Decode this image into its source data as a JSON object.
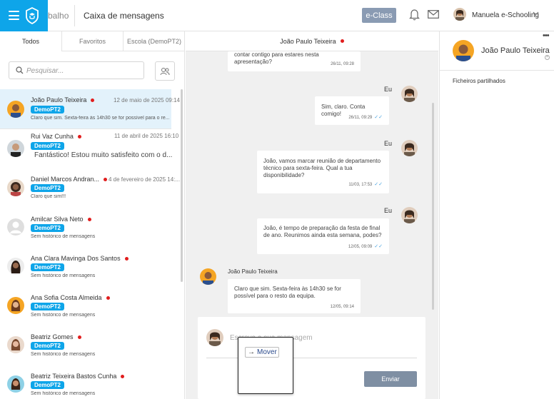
{
  "header": {
    "crumb": "balho",
    "title": "Caixa de mensagens",
    "eclass_label": "e-Class",
    "user_name": "Manuela e-Schooling"
  },
  "tabs": [
    {
      "label": "Todos",
      "active": true
    },
    {
      "label": "Favoritos",
      "active": false
    },
    {
      "label": "Escola (DemoPT2)",
      "active": false
    }
  ],
  "search": {
    "placeholder": "Pesquisar..."
  },
  "conversations": [
    {
      "name": "João Paulo Teixeira",
      "date": "12 de maio de 2025 09:14",
      "tag": "DemoPT2",
      "preview": "Claro que sim. Sexta-feira às 14h30 se for possível para o re...",
      "unread": true,
      "selected": true
    },
    {
      "name": "Rui Vaz Cunha",
      "date": "11 de abril de 2025 16:10",
      "tag": "DemoPT2",
      "preview": "Fantástico! Estou muito satisfeito com o d...",
      "unread": true,
      "selected": false
    },
    {
      "name": "Daniel Marcos Andran...",
      "date": "4 de fevereiro de 2025 14:...",
      "tag": "DemoPT2",
      "preview": "Claro que sim!!!",
      "unread": true,
      "selected": false
    },
    {
      "name": "Amilcar Silva Neto",
      "date": "",
      "tag": "DemoPT2",
      "preview": "Sem histórico de mensagens",
      "unread": true,
      "selected": false
    },
    {
      "name": "Ana Clara Mavinga Dos Santos",
      "date": "",
      "tag": "DemoPT2",
      "preview": "Sem histórico de mensagens",
      "unread": true,
      "selected": false
    },
    {
      "name": "Ana Sofia Costa Almeida",
      "date": "",
      "tag": "DemoPT2",
      "preview": "Sem histórico de mensagens",
      "unread": true,
      "selected": false
    },
    {
      "name": "Beatriz Gomes",
      "date": "",
      "tag": "DemoPT2",
      "preview": "Sem histórico de mensagens",
      "unread": true,
      "selected": false
    },
    {
      "name": "Beatriz Teixeira Bastos Cunha",
      "date": "",
      "tag": "DemoPT2",
      "preview": "Sem histórico de mensagens",
      "unread": true,
      "selected": false
    }
  ],
  "chat": {
    "contact_name": "João Paulo Teixeira",
    "me_label": "Eu",
    "messages": [
      {
        "text": "contar contigo para estares nesta apresentação?",
        "time": "26/11, 09:28"
      },
      {
        "text": "Sim, claro. Conta comigo!",
        "time": "26/11, 09:29"
      },
      {
        "text": "João, vamos marcar reunião de departamento técnico para sexta-feira. Qual a tua disponibilidade?",
        "time": "11/03, 17:53"
      },
      {
        "text": "João, é tempo de preparação da festa de final de ano. Reunimos ainda esta semana, podes?",
        "time": "12/05, 09:09"
      },
      {
        "text": "Claro que sim. Sexta-feira às 14h30 se for possível para o resto da equipa.",
        "time": "12/05, 09:14"
      }
    ],
    "compose_placeholder": "Escreva a sua mensagem",
    "send_label": "Enviar",
    "move_label": "Mover"
  },
  "details": {
    "name": "João Paulo Teixeira",
    "more": "•••",
    "files_label": "Ficheiros partilhados"
  },
  "colors": {
    "brand": "#0ea5e9",
    "tag": "#0ea5e9",
    "unread_dot": "#e11d1d",
    "selected_row": "#e3f2fb",
    "send_button": "#7f8fa3"
  }
}
